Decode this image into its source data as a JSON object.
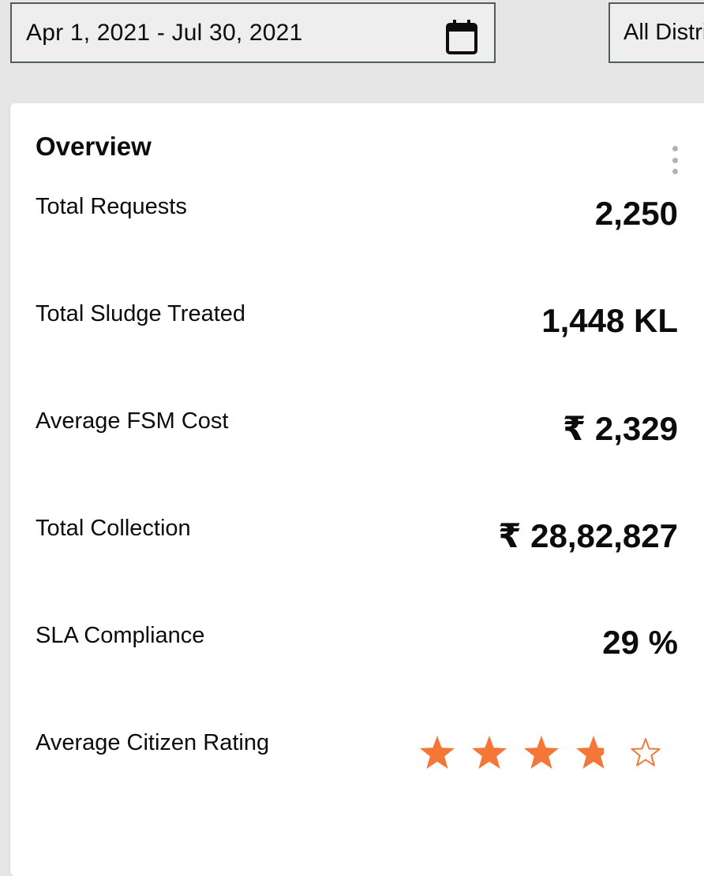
{
  "filters": {
    "date_range": "Apr 1, 2021 - Jul 30, 2021",
    "date_icon": "calendar-icon",
    "district": "All Districts"
  },
  "overview": {
    "title": "Overview",
    "menu_icon": "more-vertical-icon",
    "metrics": [
      {
        "label": "Total Requests",
        "value": "2,250"
      },
      {
        "label": "Total Sludge Treated",
        "value": "1,448 KL"
      },
      {
        "label": "Average FSM Cost",
        "value": "₹ 2,329"
      },
      {
        "label": "Total Collection",
        "value": "₹ 28,82,827"
      },
      {
        "label": "SLA Compliance",
        "value": "29 %"
      }
    ],
    "rating": {
      "label": "Average Citizen Rating",
      "value": 3.8,
      "max": 5,
      "star_color": "#f47738",
      "star_icon": "star-icon"
    }
  }
}
